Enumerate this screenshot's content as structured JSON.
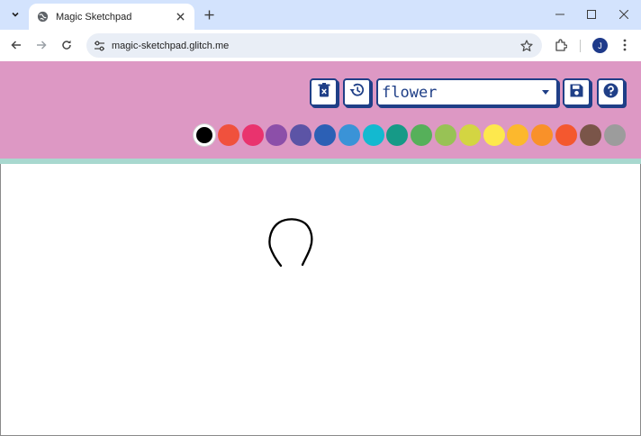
{
  "browser": {
    "tab_title": "Magic Sketchpad",
    "url": "magic-sketchpad.glitch.me",
    "avatar_letter": "J",
    "icons": {
      "tab_search": "chevron-down-icon",
      "favicon": "globe-icon",
      "tab_close": "close-icon",
      "new_tab": "plus-icon",
      "minimize": "minimize-icon",
      "maximize": "maximize-icon",
      "close": "close-icon",
      "back": "back-arrow-icon",
      "forward": "forward-arrow-icon",
      "reload": "reload-icon",
      "site_info": "tune-icon",
      "bookmark": "star-icon",
      "extensions": "puzzle-icon",
      "menu": "kebab-menu-icon"
    }
  },
  "app": {
    "model_select": {
      "value": "flower"
    },
    "buttons": {
      "clear_icon": "trash-icon",
      "history_icon": "history-icon",
      "save_icon": "floppy-disk-icon",
      "help_icon": "help-icon"
    },
    "colors": {
      "header_bg": "#dd98c4",
      "stripe": "#a8d8cf",
      "accent": "#1f3f87"
    },
    "palette": [
      {
        "color": "#000000",
        "selected": true
      },
      {
        "color": "#f0513d",
        "selected": false
      },
      {
        "color": "#e9336e",
        "selected": false
      },
      {
        "color": "#8c4fa9",
        "selected": false
      },
      {
        "color": "#5c54a6",
        "selected": false
      },
      {
        "color": "#2c60b5",
        "selected": false
      },
      {
        "color": "#3a93d7",
        "selected": false
      },
      {
        "color": "#13b9d0",
        "selected": false
      },
      {
        "color": "#169a87",
        "selected": false
      },
      {
        "color": "#56b05a",
        "selected": false
      },
      {
        "color": "#98c255",
        "selected": false
      },
      {
        "color": "#d3d542",
        "selected": false
      },
      {
        "color": "#fde84d",
        "selected": false
      },
      {
        "color": "#fcb82d",
        "selected": false
      },
      {
        "color": "#f99129",
        "selected": false
      },
      {
        "color": "#f4582f",
        "selected": false
      },
      {
        "color": "#7a5549",
        "selected": false
      },
      {
        "color": "#9c9c9c",
        "selected": false
      }
    ]
  }
}
